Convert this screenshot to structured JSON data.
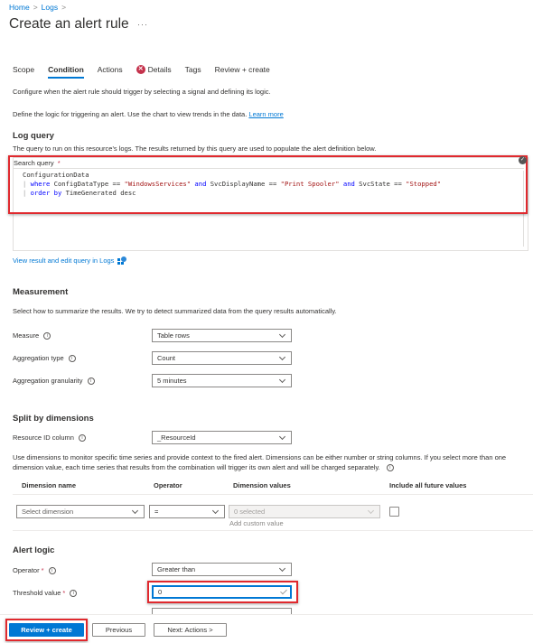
{
  "breadcrumb": [
    {
      "label": "Home"
    },
    {
      "label": "Logs"
    }
  ],
  "page": {
    "title": "Create an alert rule",
    "more": "···"
  },
  "tabs": [
    {
      "label": "Scope",
      "active": false
    },
    {
      "label": "Condition",
      "active": true
    },
    {
      "label": "Actions",
      "active": false
    },
    {
      "label": "Details",
      "active": false,
      "error": true
    },
    {
      "label": "Tags",
      "active": false
    },
    {
      "label": "Review + create",
      "active": false
    }
  ],
  "intro": {
    "line1": "Configure when the alert rule should trigger by selecting a signal and defining its logic.",
    "line2": "Define the logic for triggering an alert. Use the chart to view trends in the data.",
    "learn_more": "Learn more"
  },
  "log_query": {
    "title": "Log query",
    "description": "The query to run on this resource's logs. The results returned by this query are used to populate the alert definition below.",
    "search_label": "Search query",
    "required_mark": "*",
    "code": {
      "line1": "ConfigurationData",
      "line2_where": "where",
      "line2_a": " ConfigDataType == ",
      "line2_s1": "\"WindowsServices\"",
      "line2_and1": "and",
      "line2_b": " SvcDisplayName == ",
      "line2_s2": "\"Print Spooler\"",
      "line2_and2": "and",
      "line2_c": " SvcState == ",
      "line2_s3": "\"Stopped\"",
      "line3_order": "order by",
      "line3_rest": " TimeGenerated desc"
    },
    "view_link": "View result and edit query in Logs"
  },
  "measurement": {
    "title": "Measurement",
    "description": "Select how to summarize the results. We try to detect summarized data from the query results automatically.",
    "fields": [
      {
        "label": "Measure",
        "value": "Table rows"
      },
      {
        "label": "Aggregation type",
        "value": "Count"
      },
      {
        "label": "Aggregation granularity",
        "value": "5 minutes"
      }
    ]
  },
  "split": {
    "title": "Split by dimensions",
    "resource_label": "Resource ID column",
    "resource_value": "_ResourceId",
    "description": "Use dimensions to monitor specific time series and provide context to the fired alert. Dimensions can be either number or string columns. If you select more than one dimension value, each time series that results from the combination will trigger its own alert and will be charged separately.",
    "columns": [
      "Dimension name",
      "Operator",
      "Dimension values",
      "Include all future values"
    ],
    "row": {
      "dimension_placeholder": "Select dimension",
      "operator": "=",
      "values": "0 selected",
      "add_custom": "Add custom value"
    }
  },
  "alert_logic": {
    "title": "Alert logic",
    "operator_label": "Operator",
    "operator_value": "Greater than",
    "threshold_label": "Threshold value",
    "threshold_value": "0",
    "required_mark": "*"
  },
  "footer": {
    "review_create": "Review + create",
    "previous": "Previous",
    "next": "Next: Actions >"
  }
}
